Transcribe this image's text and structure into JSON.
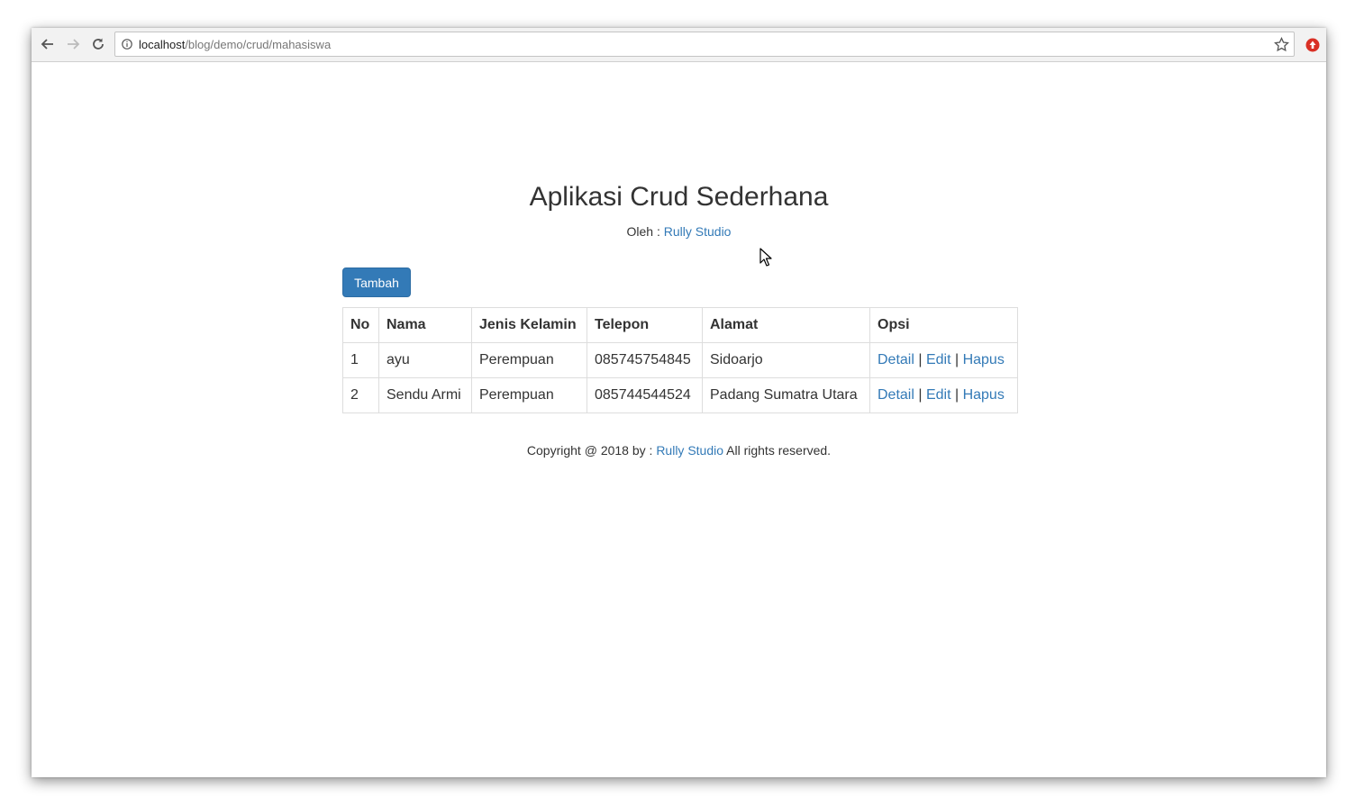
{
  "browser": {
    "url_host": "localhost",
    "url_path": "/blog/demo/crud/mahasiswa"
  },
  "page": {
    "title": "Aplikasi Crud Sederhana",
    "author_prefix": "Oleh : ",
    "author_link": "Rully Studio",
    "add_button": "Tambah"
  },
  "table": {
    "headers": [
      "No",
      "Nama",
      "Jenis Kelamin",
      "Telepon",
      "Alamat",
      "Opsi"
    ],
    "rows": [
      {
        "no": "1",
        "nama": "ayu",
        "jenis_kelamin": "Perempuan",
        "telepon": "085745754845",
        "alamat": "Sidoarjo"
      },
      {
        "no": "2",
        "nama": "Sendu Armi",
        "jenis_kelamin": "Perempuan",
        "telepon": "085744544524",
        "alamat": "Padang Sumatra Utara"
      }
    ],
    "actions": {
      "detail": "Detail",
      "edit": "Edit",
      "delete": "Hapus",
      "separator": " | "
    }
  },
  "footer": {
    "prefix": "Copyright @ 2018 by : ",
    "link": "Rully Studio",
    "suffix": " All rights reserved."
  },
  "colors": {
    "link": "#337ab7",
    "primary_button": "#337ab7",
    "text": "#333333"
  }
}
